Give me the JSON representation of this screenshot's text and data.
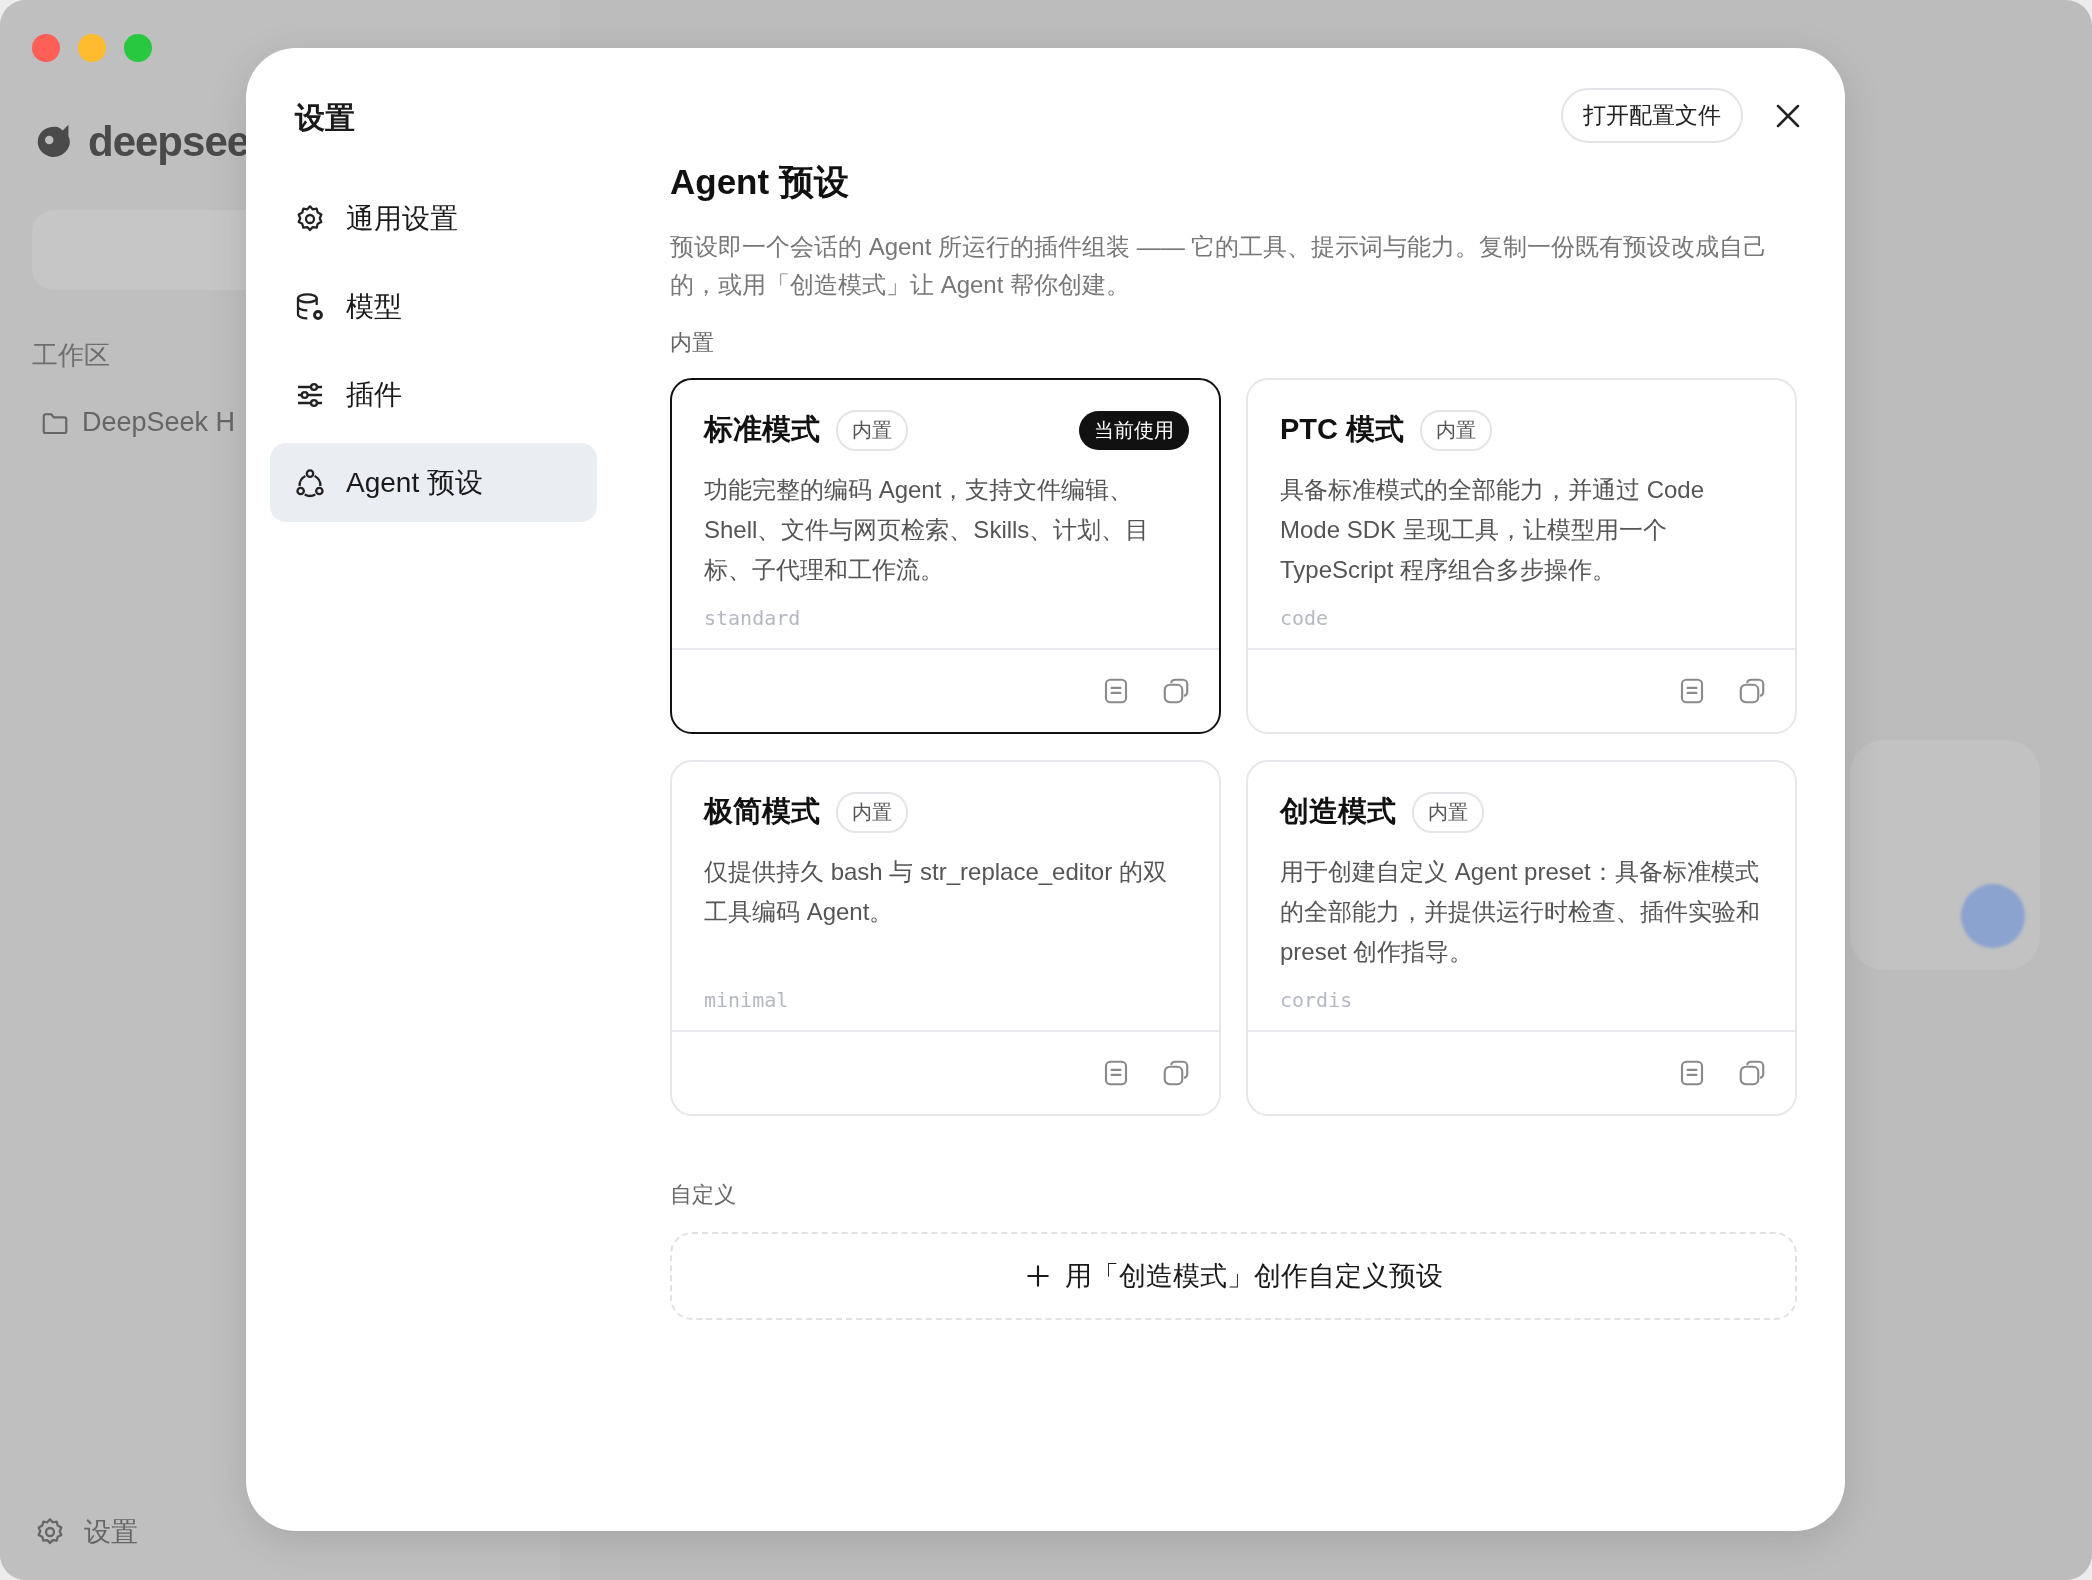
{
  "background": {
    "logo_text": "deepsee",
    "section_label": "工作区",
    "workspace_item": "DeepSeek H",
    "settings_label": "设置"
  },
  "dialog": {
    "title": "设置",
    "open_config_button": "打开配置文件",
    "nav": [
      {
        "label": "通用设置",
        "kind": "gear",
        "selected": false
      },
      {
        "label": "模型",
        "kind": "database",
        "selected": false
      },
      {
        "label": "插件",
        "kind": "sliders",
        "selected": false
      },
      {
        "label": "Agent 预设",
        "kind": "agents",
        "selected": true
      }
    ],
    "heading": "Agent 预设",
    "description": "预设即一个会话的 Agent 所运行的插件组装 —— 它的工具、提示词与能力。复制一份既有预设改成自己的，或用「创造模式」让 Agent 帮你创建。",
    "builtin_label": "内置",
    "presets": [
      {
        "title": "标准模式",
        "badge": "内置",
        "current_badge": "当前使用",
        "selected": true,
        "description": "功能完整的编码 Agent，支持文件编辑、Shell、文件与网页检索、Skills、计划、目标、子代理和工作流。",
        "id": "standard"
      },
      {
        "title": "PTC 模式",
        "badge": "内置",
        "selected": false,
        "description": "具备标准模式的全部能力，并通过 Code Mode SDK 呈现工具，让模型用一个 TypeScript 程序组合多步操作。",
        "id": "code"
      },
      {
        "title": "极简模式",
        "badge": "内置",
        "selected": false,
        "description": "仅提供持久 bash 与 str_replace_editor 的双工具编码 Agent。",
        "id": "minimal"
      },
      {
        "title": "创造模式",
        "badge": "内置",
        "selected": false,
        "description": "用于创建自定义 Agent preset：具备标准模式的全部能力，并提供运行时检查、插件实验和 preset 创作指导。",
        "id": "cordis"
      }
    ],
    "custom_label": "自定义",
    "create_button": "用「创造模式」创作自定义预设"
  }
}
